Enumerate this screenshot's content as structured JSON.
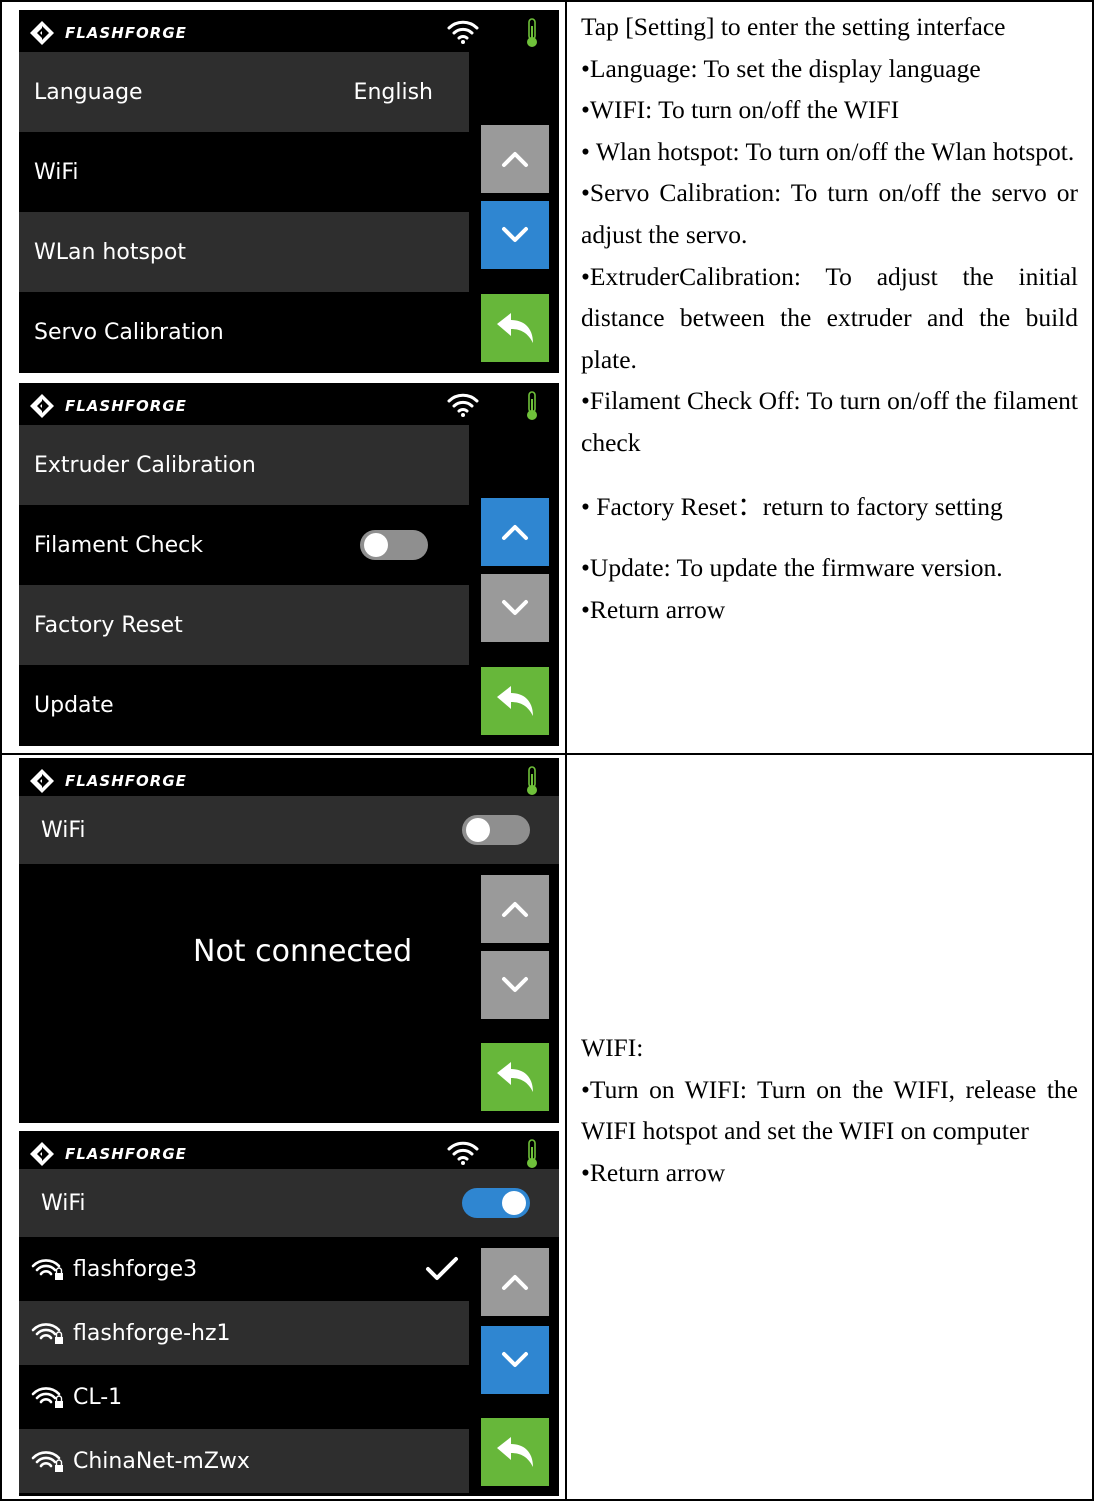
{
  "brand": "FLASHFORGE",
  "panel1": {
    "rows": [
      {
        "label": "Language",
        "value": "English"
      },
      {
        "label": "WiFi"
      },
      {
        "label": "WLan hotspot"
      },
      {
        "label": "Servo Calibration"
      }
    ]
  },
  "panel2": {
    "rows": [
      {
        "label": "Extruder Calibration"
      },
      {
        "label": "Filament Check"
      },
      {
        "label": "Factory Reset"
      },
      {
        "label": "Update"
      }
    ]
  },
  "panel3": {
    "header_label": "WiFi",
    "status": "Not connected"
  },
  "panel4": {
    "header_label": "WiFi",
    "networks": [
      "flashforge3",
      "flashforge-hz1",
      "CL-1",
      "ChinaNet-mZwx"
    ]
  },
  "text1": [
    "Tap [Setting] to enter the setting interface",
    "•Language: To set the display language",
    "•WIFI: To turn on/off the WIFI",
    "• Wlan hotspot: To turn on/off the Wlan hotspot.",
    "•Servo Calibration: To turn on/off the servo or adjust the servo.",
    "•ExtruderCalibration: To adjust the initial distance between the extruder and the build plate.",
    "•Filament Check Off: To turn on/off the filament check",
    "• Factory Reset：return to factory setting",
    "•Update: To update the firmware version.",
    "•Return arrow"
  ],
  "text2": [
    "WIFI:",
    "•Turn on WIFI: Turn on the WIFI, release the WIFI hotspot and set the WIFI on computer",
    "•Return arrow"
  ],
  "colors": {
    "row_grey": "#2e2e2e",
    "button_grey": "#9a9a9a",
    "button_blue": "#2f86d1",
    "button_green": "#67b73a",
    "thermometer_green": "#6fc13a"
  }
}
